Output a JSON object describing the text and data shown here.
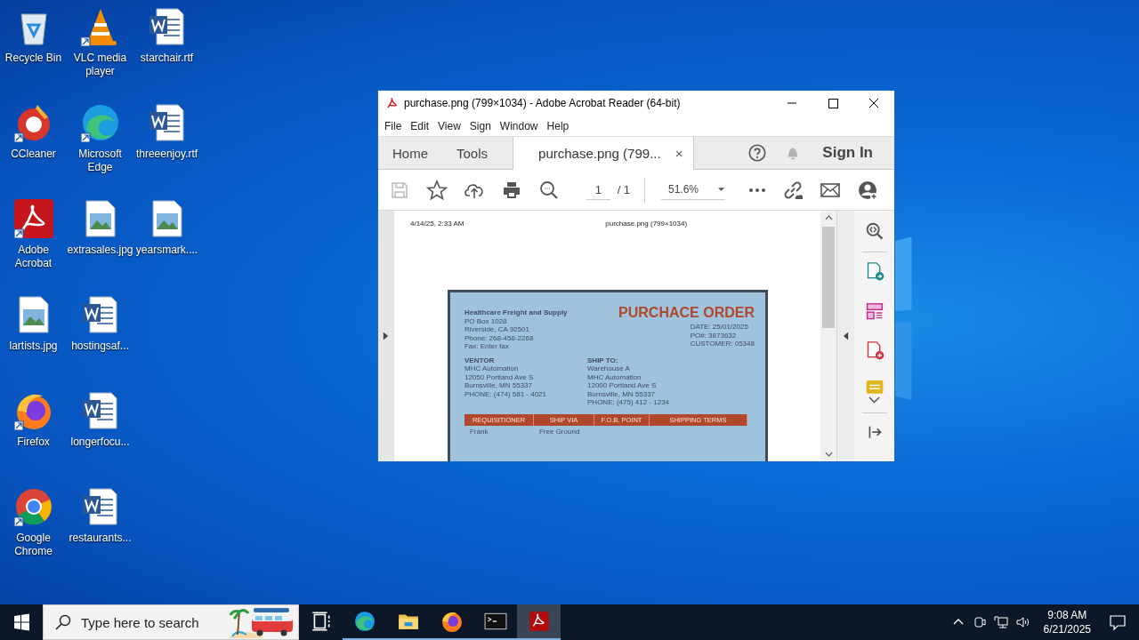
{
  "desktop_icons": [
    {
      "label": "Recycle Bin",
      "kind": "recycle",
      "shortcut": false
    },
    {
      "label": "CCleaner",
      "kind": "ccleaner",
      "shortcut": true
    },
    {
      "label": "Adobe Acrobat",
      "kind": "acrobat",
      "shortcut": true
    },
    {
      "label": "lartists.jpg",
      "kind": "image",
      "shortcut": false
    },
    {
      "label": "Firefox",
      "kind": "firefox",
      "shortcut": true
    },
    {
      "label": "Google Chrome",
      "kind": "chrome",
      "shortcut": true
    },
    {
      "label": "VLC media player",
      "kind": "vlc",
      "shortcut": true
    },
    {
      "label": "Microsoft Edge",
      "kind": "edge",
      "shortcut": true
    },
    {
      "label": "extrasales.jpg",
      "kind": "image",
      "shortcut": false
    },
    {
      "label": "hostingsaf...",
      "kind": "word",
      "shortcut": false
    },
    {
      "label": "longerfocu...",
      "kind": "word",
      "shortcut": false
    },
    {
      "label": "restaurants...",
      "kind": "word",
      "shortcut": false
    },
    {
      "label": "starchair.rtf",
      "kind": "word",
      "shortcut": false
    },
    {
      "label": "threeenjoy.rtf",
      "kind": "word",
      "shortcut": false
    },
    {
      "label": "yearsmark....",
      "kind": "image",
      "shortcut": false
    }
  ],
  "window": {
    "title": "purchase.png (799×1034) - Adobe Acrobat Reader (64-bit)",
    "menu": [
      "File",
      "Edit",
      "View",
      "Sign",
      "Window",
      "Help"
    ],
    "tabs": [
      {
        "label": "Home",
        "selected": false
      },
      {
        "label": "Tools",
        "selected": false
      },
      {
        "label": "purchase.png (799...",
        "selected": true
      }
    ],
    "tab_close": "×",
    "sign_in": "Sign In",
    "page_current": "1",
    "page_total": "/ 1",
    "zoom": "51.6%",
    "page_header": {
      "left": "4/14/25, 2:33 AM",
      "right": "purchase.png (799×1034)"
    },
    "order": {
      "company": "Healthcare Freight and Supply",
      "company_lines": [
        "PO Box 1028",
        "Riverside, CA 92501",
        "Phone: 268-458-2268",
        "Fax: Enter fax"
      ],
      "title": "PURCHACE ORDER",
      "meta_lines": [
        "DATE: 25/01/2025",
        "PO#: 3873632",
        "CUSTOMER: 05348"
      ],
      "vendor_heading": "VENTOR",
      "vendor_lines": [
        "MHC Automation",
        "12050 Portland Ave S",
        "Burnsville, MN 55337",
        "PHONE: (474) 581 - 4021"
      ],
      "ship_heading": "SHIP TO:",
      "ship_lines": [
        "Warehouse A",
        "MHC Automation",
        "12000 Portland Ave S",
        "Burnsville, MN 55337",
        "PHONE: (475) 412 - 1234"
      ],
      "columns": [
        "REQUISITIONER",
        "SHIP VIA",
        "F.O.B. POINT",
        "SHIPPING TERMS"
      ],
      "row": [
        "Frank",
        "Free Ground"
      ]
    }
  },
  "taskbar": {
    "search_placeholder": "Type here to search",
    "apps": [
      {
        "kind": "taskview",
        "running": false,
        "active": false
      },
      {
        "kind": "edge",
        "running": true,
        "active": false
      },
      {
        "kind": "explorer",
        "running": true,
        "active": false
      },
      {
        "kind": "firefox",
        "running": true,
        "active": false
      },
      {
        "kind": "terminal",
        "running": true,
        "active": false
      },
      {
        "kind": "acrobat",
        "running": true,
        "active": true
      }
    ],
    "time": "9:08 AM",
    "date": "6/21/2025"
  }
}
